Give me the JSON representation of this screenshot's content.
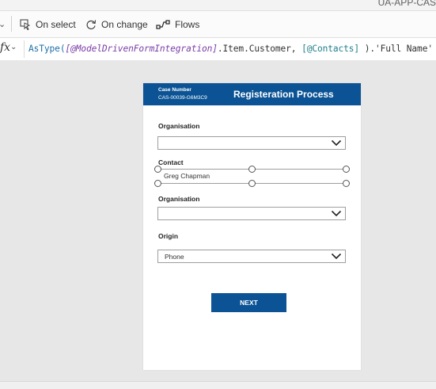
{
  "window": {
    "title": "UA-APP-CAS"
  },
  "toolbar": {
    "on_select_label": "On select",
    "on_change_label": "On change",
    "flows_label": "Flows"
  },
  "formula_bar": {
    "fx_label": "fx",
    "formula_fn": "AsType(",
    "formula_integration": "[@ModelDrivenFormIntegration]",
    "formula_mid": ".Item.Customer, ",
    "formula_contacts": "[@Contacts]",
    "formula_end": " ).'Full Name'"
  },
  "form": {
    "case_number_label": "Case Number",
    "case_number_value": "CAS-00039-G6M3C9",
    "title": "Registeration Process",
    "organisation_label_1": "Organisation",
    "organisation_value_1": "",
    "contact_label": "Contact",
    "contact_value": "Greg Chapman",
    "organisation_label_2": "Organisation",
    "organisation_value_2": "",
    "origin_label": "Origin",
    "origin_value": "Phone",
    "next_label": "NEXT"
  },
  "colors": {
    "brand_blue": "#0b5394",
    "formula_function": "#1e6fa8",
    "formula_keyword": "#7a3da8",
    "formula_datasource": "#1f7f8a"
  },
  "icons": {
    "on_select": "cursor-select-icon",
    "on_change": "refresh-icon",
    "flows": "flow-icon",
    "dropdown": "chevron-down-icon"
  }
}
